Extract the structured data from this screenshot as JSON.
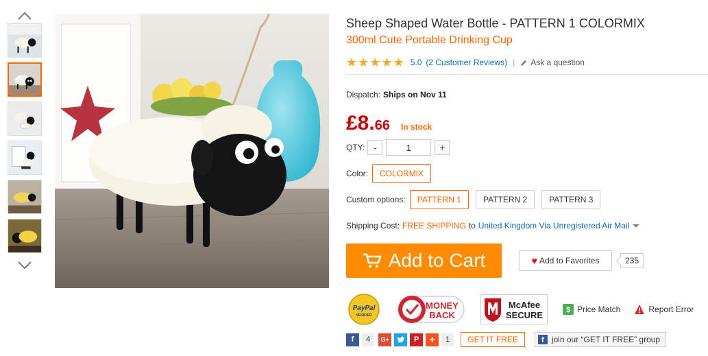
{
  "product": {
    "title": "Sheep Shaped Water Bottle  -  PATTERN 1  COLORMIX",
    "subtitle": "300ml Cute Portable Drinking Cup",
    "rating_value": "5.0",
    "stars": 5,
    "reviews_link": "(2 Customer Reviews)",
    "separator": "|",
    "ask_question": "Ask a question"
  },
  "dispatch": {
    "label": "Dispatch:",
    "value": "Ships on Nov 11"
  },
  "price": {
    "main": "£8.",
    "cents": "66",
    "stock": "In stock"
  },
  "quantity": {
    "label": "QTY:",
    "value": "1",
    "minus": "-",
    "plus": "+"
  },
  "color": {
    "label": "Color:",
    "options": [
      "COLORMIX"
    ],
    "selected": "COLORMIX"
  },
  "custom_options": {
    "label": "Custom options:",
    "options": [
      "PATTERN 1",
      "PATTERN 2",
      "PATTERN 3"
    ],
    "selected": "PATTERN 1"
  },
  "shipping": {
    "label": "Shipping Cost:",
    "free": "FREE SHIPPING",
    "to": "to",
    "destination": "United Kingdom Via Unregistered Air Mail"
  },
  "actions": {
    "add_to_cart": "Add to Cart",
    "add_to_favorites": "Add to Favorites",
    "favorites_count": "235"
  },
  "badges": {
    "paypal_top": "PayPal",
    "paypal_bottom": "VERIFIED",
    "money_back_1": "MONEY",
    "money_back_2": "BACK",
    "mcafee_1": "McAfee",
    "mcafee_2": "SECURE",
    "price_match": "Price Match",
    "report_error": "Report Error"
  },
  "share": {
    "facebook": "f",
    "facebook_count": "4",
    "googleplus": "G+",
    "pinterest": "P",
    "more": "+",
    "more_count": "1",
    "get_it_free": "GET IT FREE",
    "group_text": "join our “GET IT FREE” group"
  },
  "colors": {
    "accent": "#ff6600",
    "cart": "#ff8c00",
    "price": "#cc0000",
    "link": "#0e6bb0",
    "star": "#f9a825"
  },
  "icons": [
    "chevron-up-icon",
    "chevron-down-icon",
    "star-icon",
    "pencil-icon",
    "cart-icon",
    "heart-icon",
    "price-match-icon",
    "warning-icon",
    "facebook-icon",
    "googleplus-icon",
    "twitter-icon",
    "pinterest-icon",
    "plus-icon"
  ]
}
